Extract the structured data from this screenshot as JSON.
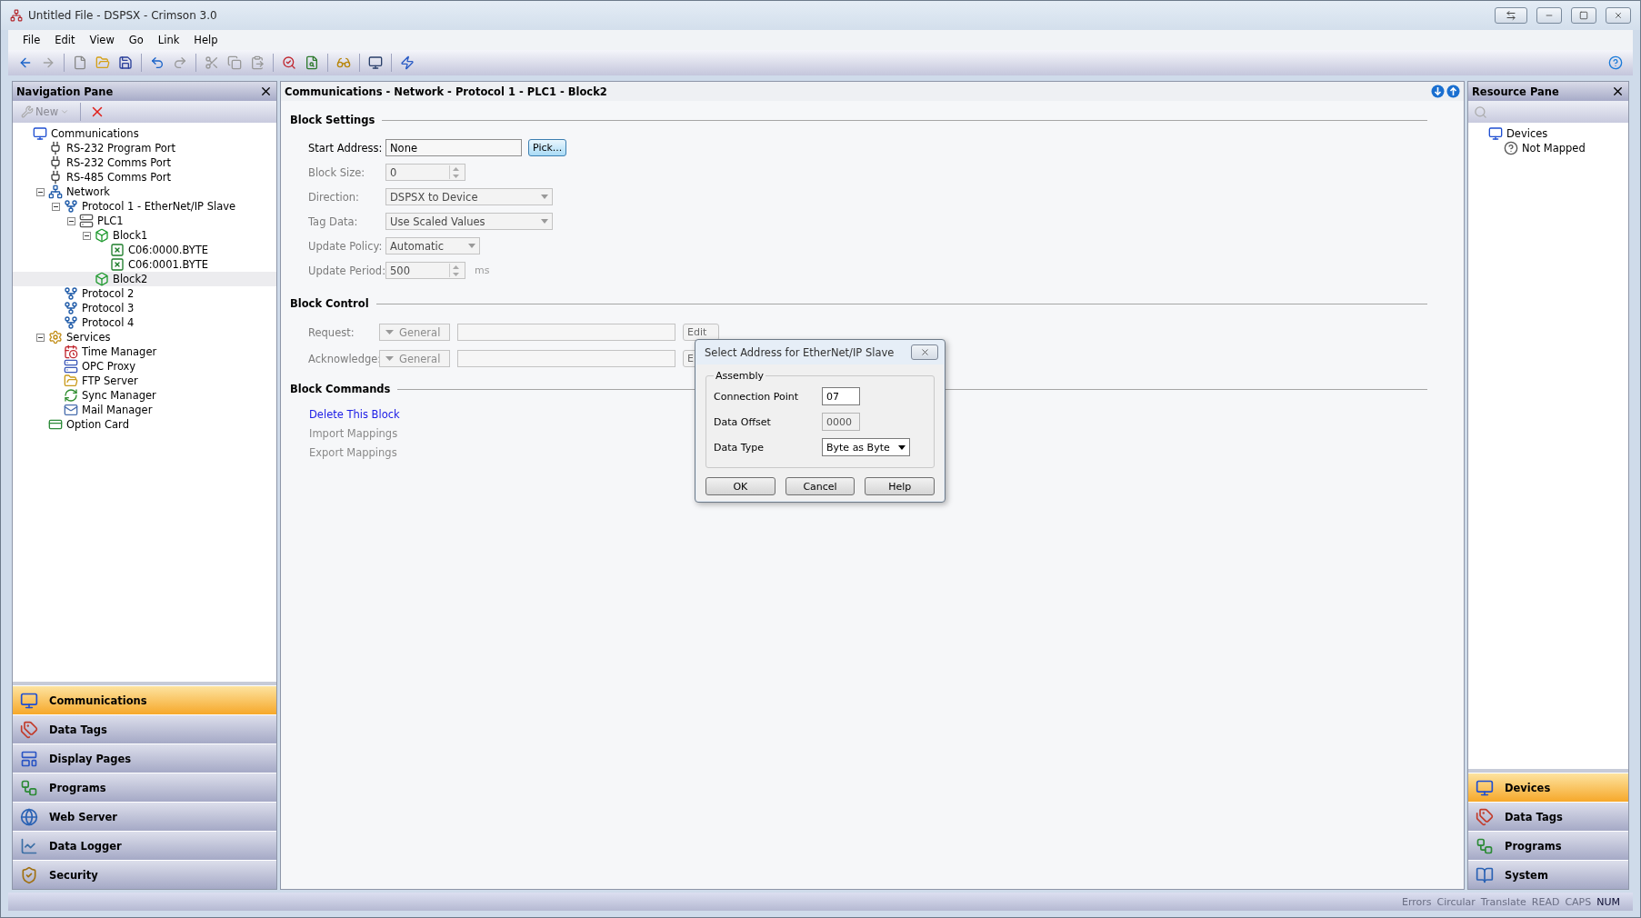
{
  "window": {
    "title": "Untitled File - DSPSX - Crimson 3.0"
  },
  "menu": [
    "File",
    "Edit",
    "View",
    "Go",
    "Link",
    "Help"
  ],
  "navigation_pane": {
    "title": "Navigation Pane",
    "new_button": {
      "label": "New",
      "disabled": true
    },
    "tree": [
      {
        "label": "Communications",
        "kind": "computer",
        "selected": false,
        "children": [
          {
            "label": "RS-232 Program Port",
            "kind": "port",
            "selected": false
          },
          {
            "label": "RS-232 Comms Port",
            "kind": "port",
            "selected": false
          },
          {
            "label": "RS-485 Comms Port",
            "kind": "port",
            "selected": false
          },
          {
            "label": "Network",
            "kind": "network",
            "selected": false,
            "expanded": true,
            "children": [
              {
                "label": "Protocol 1 - EtherNet/IP Slave",
                "kind": "protocol",
                "selected": false,
                "expanded": true,
                "children": [
                  {
                    "label": "PLC1",
                    "kind": "plc",
                    "selected": false,
                    "expanded": true,
                    "children": [
                      {
                        "label": "Block1",
                        "kind": "block",
                        "selected": false,
                        "expanded": true,
                        "children": [
                          {
                            "label": "C06:0000.BYTE",
                            "kind": "tag",
                            "selected": false
                          },
                          {
                            "label": "C06:0001.BYTE",
                            "kind": "tag",
                            "selected": false
                          }
                        ]
                      },
                      {
                        "label": "Block2",
                        "kind": "block",
                        "selected": true
                      }
                    ]
                  }
                ]
              },
              {
                "label": "Protocol 2",
                "kind": "protocol",
                "selected": false
              },
              {
                "label": "Protocol 3",
                "kind": "protocol",
                "selected": false
              },
              {
                "label": "Protocol 4",
                "kind": "protocol",
                "selected": false
              }
            ]
          },
          {
            "label": "Services",
            "kind": "services",
            "selected": false,
            "expanded": true,
            "children": [
              {
                "label": "Time Manager",
                "kind": "clock",
                "selected": false
              },
              {
                "label": "OPC Proxy",
                "kind": "server",
                "selected": false
              },
              {
                "label": "FTP Server",
                "kind": "folder",
                "selected": false
              },
              {
                "label": "Sync Manager",
                "kind": "sync",
                "selected": false
              },
              {
                "label": "Mail Manager",
                "kind": "mail",
                "selected": false
              }
            ]
          },
          {
            "label": "Option Card",
            "kind": "card",
            "selected": false
          }
        ]
      }
    ],
    "categories": [
      {
        "label": "Communications",
        "kind": "computer",
        "selected": true
      },
      {
        "label": "Data Tags",
        "kind": "tags",
        "selected": false
      },
      {
        "label": "Display Pages",
        "kind": "pages",
        "selected": false
      },
      {
        "label": "Programs",
        "kind": "programs",
        "selected": false
      },
      {
        "label": "Web Server",
        "kind": "web",
        "selected": false
      },
      {
        "label": "Data Logger",
        "kind": "logger",
        "selected": false
      },
      {
        "label": "Security",
        "kind": "security",
        "selected": false
      }
    ]
  },
  "main": {
    "breadcrumb": "Communications - Network - Protocol 1 - PLC1 - Block2",
    "block_settings": {
      "title": "Block Settings",
      "fields": [
        {
          "label": "Start Address:",
          "kind": "text",
          "value": "None",
          "disabled": false,
          "button": "Pick..."
        },
        {
          "label": "Block Size:",
          "kind": "spin",
          "value": "0",
          "disabled": true
        },
        {
          "label": "Direction:",
          "kind": "select",
          "value": "DSPSX to Device",
          "disabled": true
        },
        {
          "label": "Tag Data:",
          "kind": "select",
          "value": "Use Scaled Values",
          "disabled": true
        },
        {
          "label": "Update Policy:",
          "kind": "select",
          "value": "Automatic",
          "disabled": true
        },
        {
          "label": "Update Period:",
          "kind": "spin",
          "value": "500",
          "disabled": true,
          "unit": "ms"
        }
      ]
    },
    "block_control": {
      "title": "Block Control",
      "rows": [
        {
          "label": "Request:",
          "mode": "General",
          "button": "Edit",
          "disabled": true
        },
        {
          "label": "Acknowledge:",
          "mode": "General",
          "button": "E",
          "disabled": true
        }
      ]
    },
    "block_commands": {
      "title": "Block Commands",
      "links": [
        {
          "label": "Delete This Block",
          "disabled": false
        },
        {
          "label": "Import Mappings",
          "disabled": true
        },
        {
          "label": "Export Mappings",
          "disabled": true
        }
      ]
    }
  },
  "resource_pane": {
    "title": "Resource Pane",
    "tree": [
      {
        "label": "Devices",
        "kind": "computer",
        "selected": false,
        "children": [
          {
            "label": "Not Mapped",
            "kind": "unknown",
            "selected": false
          }
        ]
      }
    ],
    "categories": [
      {
        "label": "Devices",
        "kind": "computer",
        "selected": true
      },
      {
        "label": "Data Tags",
        "kind": "tags",
        "selected": false
      },
      {
        "label": "Programs",
        "kind": "programs",
        "selected": false
      },
      {
        "label": "System",
        "kind": "system",
        "selected": false
      }
    ]
  },
  "dialog": {
    "title": "Select Address for EtherNet/IP Slave",
    "group": "Assembly",
    "fields": [
      {
        "label": "Connection Point",
        "kind": "text",
        "value": "07",
        "disabled": false
      },
      {
        "label": "Data Offset",
        "kind": "text",
        "value": "0000",
        "disabled": true
      },
      {
        "label": "Data Type",
        "kind": "select",
        "value": "Byte as Byte",
        "disabled": false
      }
    ],
    "buttons": [
      "OK",
      "Cancel",
      "Help"
    ]
  },
  "status_bar": [
    {
      "label": "Errors",
      "on": false
    },
    {
      "label": "Circular",
      "on": false
    },
    {
      "label": "Translate",
      "on": false
    },
    {
      "label": "READ",
      "on": false
    },
    {
      "label": "CAPS",
      "on": false
    },
    {
      "label": "NUM",
      "on": true
    }
  ]
}
